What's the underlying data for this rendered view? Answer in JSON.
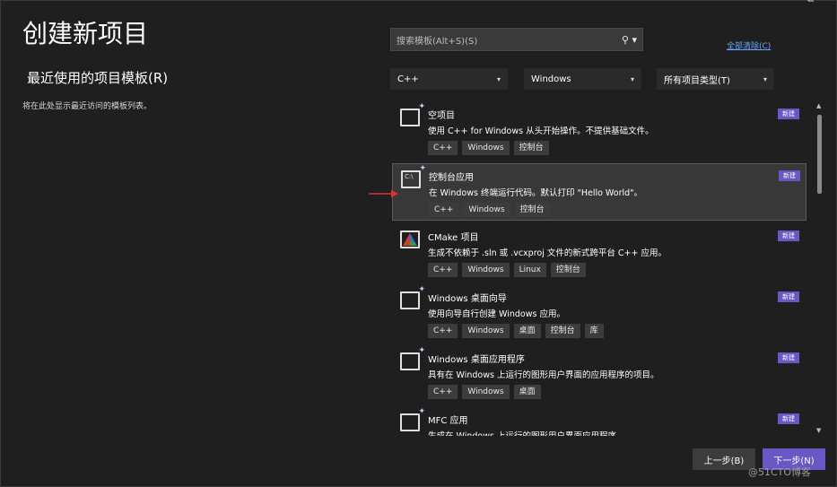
{
  "page": {
    "title": "创建新项目",
    "recent_title": "最近使用的项目模板(R)",
    "recent_desc": "将在此处显示最近访问的模板列表。"
  },
  "window_controls": [
    "—",
    "⧉"
  ],
  "search": {
    "placeholder": "搜索模板(Alt+S)(S)",
    "icon": "search-icon"
  },
  "clear_all": "全部清除(C)",
  "filters": {
    "language": "C++",
    "platform": "Windows",
    "project_type": "所有项目类型(T)"
  },
  "templates": [
    {
      "name": "空项目",
      "desc": "使用 C++ for Windows 从头开始操作。不提供基础文件。",
      "tags": [
        "C++",
        "Windows",
        "控制台"
      ],
      "new": "新建",
      "icon": "empty-project-icon"
    },
    {
      "name": "控制台应用",
      "desc": "在 Windows 终端运行代码。默认打印 \"Hello World\"。",
      "tags": [
        "C++",
        "Windows",
        "控制台"
      ],
      "new": "新建",
      "icon": "console-app-icon",
      "glyph": "C:\\"
    },
    {
      "name": "CMake 项目",
      "desc": "生成不依赖于 .sln 或 .vcxproj 文件的新式跨平台 C++ 应用。",
      "tags": [
        "C++",
        "Windows",
        "Linux",
        "控制台"
      ],
      "new": "新建",
      "icon": "cmake-icon"
    },
    {
      "name": "Windows 桌面向导",
      "desc": "使用向导自行创建 Windows 应用。",
      "tags": [
        "C++",
        "Windows",
        "桌面",
        "控制台",
        "库"
      ],
      "new": "新建",
      "icon": "desktop-wizard-icon"
    },
    {
      "name": "Windows 桌面应用程序",
      "desc": "具有在 Windows 上运行的图形用户界面的应用程序的项目。",
      "tags": [
        "C++",
        "Windows",
        "桌面"
      ],
      "new": "新建",
      "icon": "desktop-app-icon"
    },
    {
      "name": "MFC 应用",
      "desc": "生成在 Windows 上运行的图形用户界面应用程序",
      "tags": [],
      "new": "新建",
      "icon": "mfc-icon"
    }
  ],
  "buttons": {
    "back": "上一步(B)",
    "next": "下一步(N)"
  },
  "watermark": "@51CTO博客",
  "colors": {
    "background": "#1f1f1f",
    "accent": "#6b57c4",
    "link": "#6aa3ff",
    "arrow": "#e03030"
  }
}
